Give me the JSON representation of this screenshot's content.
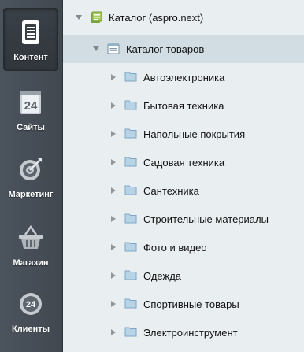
{
  "sidebar": {
    "items": [
      {
        "label": "Контент",
        "icon": "document-icon",
        "active": true
      },
      {
        "label": "Сайты",
        "icon": "calendar-24-icon",
        "active": false
      },
      {
        "label": "Маркетинг",
        "icon": "target-icon",
        "active": false
      },
      {
        "label": "Магазин",
        "icon": "basket-icon",
        "active": false
      },
      {
        "label": "Клиенты",
        "icon": "clients-24-icon",
        "active": false
      }
    ],
    "calendar_badge": "24",
    "clients_badge": "24"
  },
  "tree": {
    "root": {
      "label": "Каталог (aspro.next)",
      "icon": "catalog-module-icon",
      "expanded": true
    },
    "section": {
      "label": "Каталог товаров",
      "icon": "infoblock-icon",
      "expanded": true,
      "selected": true
    },
    "items": [
      {
        "label": "Автоэлектроника"
      },
      {
        "label": "Бытовая техника"
      },
      {
        "label": "Напольные покрытия"
      },
      {
        "label": "Садовая техника"
      },
      {
        "label": "Сантехника"
      },
      {
        "label": "Строительные материалы"
      },
      {
        "label": "Фото и видео"
      },
      {
        "label": "Одежда"
      },
      {
        "label": "Спортивные товары"
      },
      {
        "label": "Электроинструмент"
      }
    ]
  },
  "colors": {
    "sidebar": "#454c55",
    "panel": "#e9eef1",
    "selected_row": "#d1dde2",
    "folder": "#9fc4de"
  }
}
